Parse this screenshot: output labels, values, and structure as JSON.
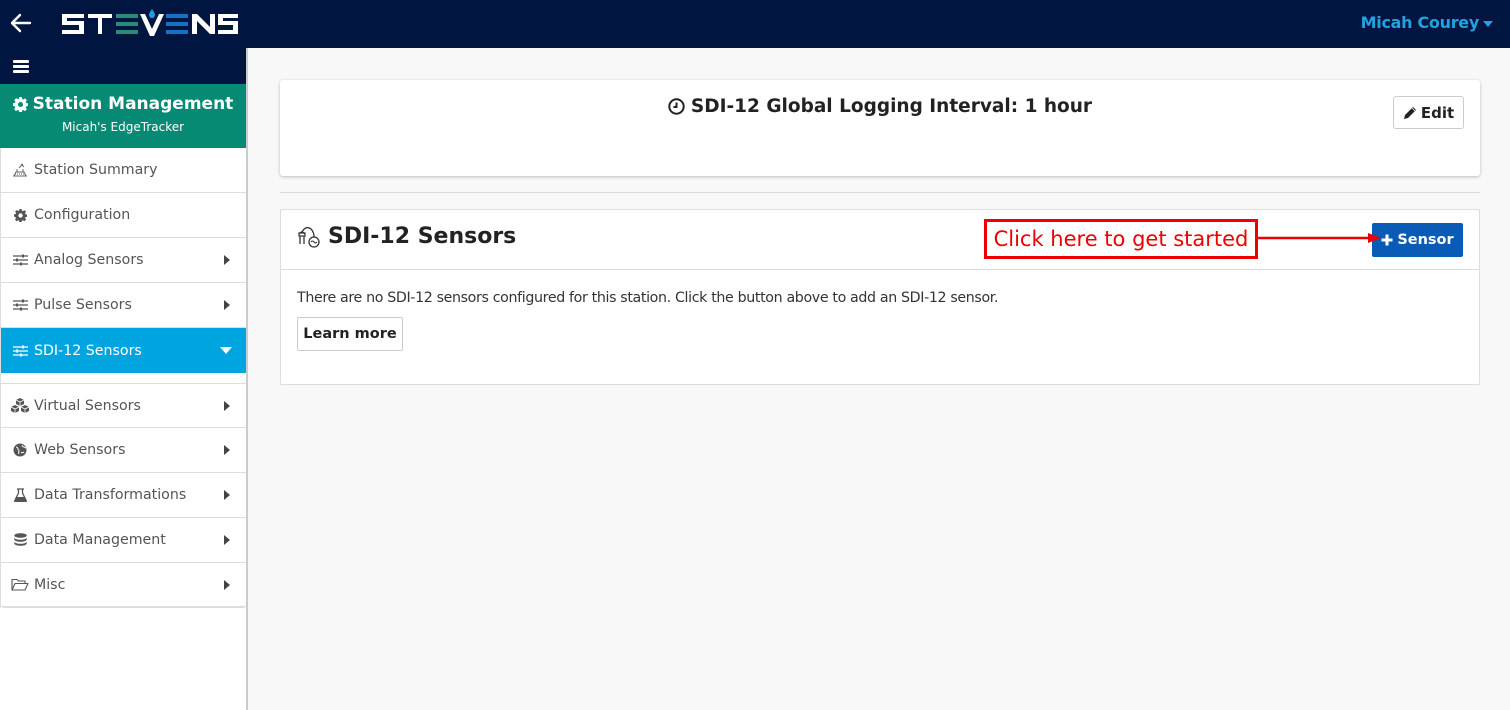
{
  "topbar": {
    "back_icon": "arrow-left-icon",
    "logo_text": "STEVENS",
    "user_name": "Micah Courey",
    "user_caret_icon": "caret-down-icon"
  },
  "sidebar": {
    "menu_icon": "hamburger-icon",
    "header": {
      "icon": "gear-icon",
      "title": "Station Management",
      "subtitle": "Micah's EdgeTracker"
    },
    "items": [
      {
        "label": "Station Summary",
        "icon": "station-icon",
        "has_arrow": false
      },
      {
        "label": "Configuration",
        "icon": "gear-icon",
        "has_arrow": false
      },
      {
        "label": "Analog Sensors",
        "icon": "sliders-icon",
        "has_arrow": true
      },
      {
        "label": "Pulse Sensors",
        "icon": "sliders-icon",
        "has_arrow": true
      },
      {
        "label": "SDI-12 Sensors",
        "icon": "sliders-icon",
        "has_arrow": true,
        "active": true
      },
      {
        "label": "Virtual Sensors",
        "icon": "cubes-icon",
        "has_arrow": true
      },
      {
        "label": "Web Sensors",
        "icon": "globe-icon",
        "has_arrow": true
      },
      {
        "label": "Data Transformations",
        "icon": "flask-icon",
        "has_arrow": true
      },
      {
        "label": "Data Management",
        "icon": "database-icon",
        "has_arrow": true
      },
      {
        "label": "Misc",
        "icon": "folder-open-icon",
        "has_arrow": true
      }
    ]
  },
  "interval_card": {
    "icon": "clock-icon",
    "title": "SDI-12 Global Logging Interval: 1 hour",
    "edit_label": "Edit",
    "edit_icon": "pencil-icon"
  },
  "sensors_card": {
    "icon": "sdi12-sensor-icon",
    "title": "SDI-12 Sensors",
    "add_button_label": "Sensor",
    "add_button_icon": "plus-icon",
    "empty_message": "There are no SDI-12 sensors configured for this station. Click the button above to add an SDI-12 sensor.",
    "learn_more_label": "Learn more"
  },
  "annotation": {
    "text": "Click here to get started",
    "color": "#ee0000"
  },
  "colors": {
    "navbar": "#00153f",
    "sidebar_header": "#078a73",
    "active_item": "#00a5e0",
    "primary_button": "#0a5bb5",
    "user_link": "#22a3e0"
  }
}
